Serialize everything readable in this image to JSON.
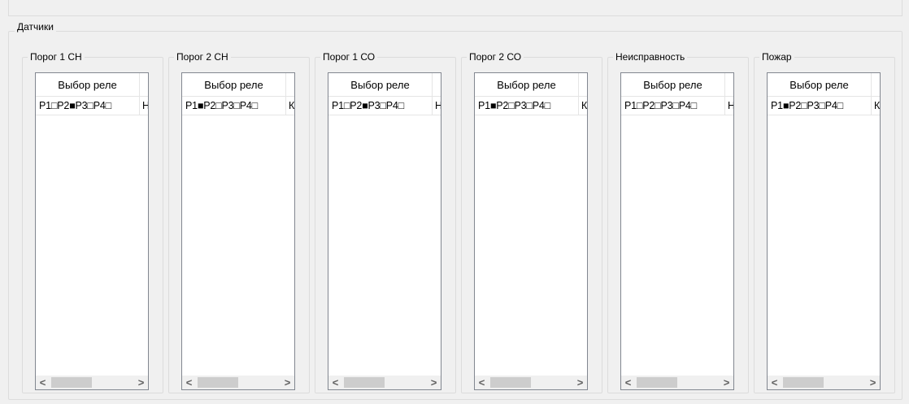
{
  "outer_group": {
    "title": "Датчики"
  },
  "groups": [
    {
      "title": "Порог 1 СН",
      "header": "Выбор реле",
      "relays": "P1□P2■P3□P4□",
      "extra": "Н"
    },
    {
      "title": "Порог 2 СН",
      "header": "Выбор реле",
      "relays": "P1■P2□P3□P4□",
      "extra": "К"
    },
    {
      "title": "Порог 1 СО",
      "header": "Выбор реле",
      "relays": "P1□P2■P3□P4□",
      "extra": "Н"
    },
    {
      "title": "Порог 2 СО",
      "header": "Выбор реле",
      "relays": "P1■P2□P3□P4□",
      "extra": "К"
    },
    {
      "title": "Неисправность",
      "header": "Выбор реле",
      "relays": "P1□P2□P3□P4□",
      "extra": "Н"
    },
    {
      "title": "Пожар",
      "header": "Выбор реле",
      "relays": "P1■P2□P3□P4□",
      "extra": "К"
    }
  ],
  "scrollbar": {
    "left_arrow": "<",
    "right_arrow": ">"
  }
}
